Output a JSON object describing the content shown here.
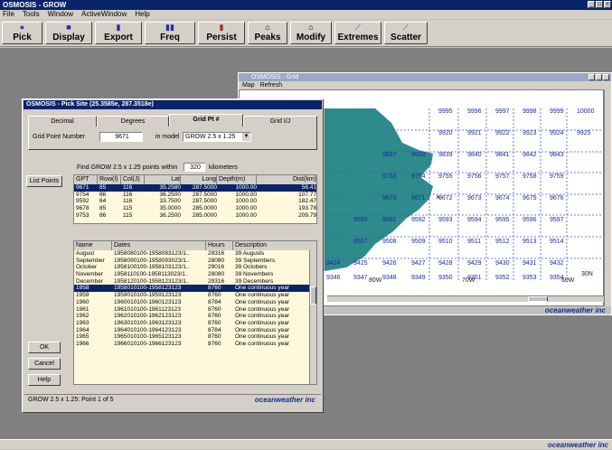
{
  "app": {
    "title": "OSMOSIS - GROW",
    "brand": "oceanweather inc"
  },
  "menu": [
    "File",
    "Tools",
    "Window",
    "ActiveWindow",
    "Help"
  ],
  "toolbar": [
    {
      "label": "Pick",
      "icon": "pick-icon",
      "glyph": "●",
      "color": "#1a4aa8"
    },
    {
      "label": "Display",
      "icon": "display-icon",
      "glyph": "■",
      "color": "#2a2aa8"
    },
    {
      "label": "Export",
      "icon": "export-icon",
      "glyph": "▮",
      "color": "#2a2aa8"
    },
    {
      "label": "Freq",
      "icon": "freq-icon",
      "glyph": "▮▮",
      "color": "#2a2aa8"
    },
    {
      "label": "Persist",
      "icon": "persist-icon",
      "glyph": "▮",
      "color": "#a82a2a"
    },
    {
      "label": "Peaks",
      "icon": "peaks-icon",
      "glyph": "⌂",
      "color": "#444"
    },
    {
      "label": "Modify",
      "icon": "modify-icon",
      "glyph": "⌂",
      "color": "#444"
    },
    {
      "label": "Extremes",
      "icon": "extremes-icon",
      "glyph": "⟋",
      "color": "#8a2a8a"
    },
    {
      "label": "Scatter",
      "icon": "scatter-icon",
      "glyph": "⟋",
      "color": "#a82a2a"
    }
  ],
  "grid": {
    "title": "OSMOSIS - Grid",
    "menu": [
      "Map",
      "Refresh"
    ],
    "rows": [
      [
        "",
        "",
        "",
        "",
        "9995",
        "9996",
        "9997",
        "9998",
        "9999",
        "10000"
      ],
      [
        "",
        "",
        "",
        "",
        "9920",
        "9921",
        "9922",
        "9923",
        "9924",
        "9925"
      ],
      [
        "",
        "",
        "9837",
        "9838",
        "9839",
        "9840",
        "9841",
        "9842",
        "9843",
        ""
      ],
      [
        "",
        "",
        "9753",
        "9754",
        "9755",
        "9756",
        "9757",
        "9758",
        "9759",
        ""
      ],
      [
        "",
        "",
        "9670",
        "9671",
        "9672",
        "9673",
        "9674",
        "9675",
        "9676",
        ""
      ],
      [
        "",
        "9590",
        "9591",
        "9592",
        "9593",
        "9594",
        "9595",
        "9596",
        "9597",
        ""
      ],
      [
        "",
        "9507",
        "9508",
        "9509",
        "9510",
        "9511",
        "9512",
        "9513",
        "9514",
        ""
      ],
      [
        "9424",
        "9425",
        "9426",
        "9427",
        "9428",
        "9429",
        "9430",
        "9431",
        "9432",
        ""
      ],
      [
        "9346",
        "9347",
        "9348",
        "9349",
        "9350",
        "9351",
        "9352",
        "9353",
        "9354",
        ""
      ]
    ],
    "x_labels": [
      "80W",
      "70W",
      "60W"
    ],
    "y_label": "30N"
  },
  "pick": {
    "title": "OSMOSIS - Pick Site (25.3585e, 287.3518e)",
    "tabs": [
      "Decimal",
      "Degrees",
      "Grid Pt #",
      "Grid I/J"
    ],
    "grid_point_label": "Grid Point Number",
    "grid_point_value": "9671",
    "model_label": "in model",
    "model_value": "GROW 2.5 x 1.25",
    "find_prefix": "Find GROW 2.5 x 1.25 points within",
    "find_value": "320",
    "find_suffix": "kilometers",
    "list_points_label": "List Points",
    "points_headers": [
      "GPT",
      "Row(I)",
      "Col(J)",
      "Lat",
      "Long",
      "Depth(m)",
      "Dist(km)"
    ],
    "points": [
      [
        "9671",
        "85",
        "116",
        "35.2580",
        "287.5000",
        "1000.00",
        "56.41"
      ],
      [
        "9754",
        "86",
        "116",
        "36.2500",
        "287.5000",
        "1000.00",
        "107.77"
      ],
      [
        "9592",
        "84",
        "116",
        "33.7500",
        "287.5000",
        "1000.00",
        "182.47"
      ],
      [
        "9678",
        "85",
        "115",
        "35.0000",
        "285.0000",
        "1000.00",
        "193.78"
      ],
      [
        "9753",
        "86",
        "115",
        "36.2500",
        "285.0000",
        "1000.00",
        "209.79"
      ]
    ],
    "periods_headers": [
      "Name",
      "Dates",
      "Hours",
      "Description"
    ],
    "periods": [
      [
        "August",
        "1958080100-1958083123/1..",
        "29316",
        "39 Augusts"
      ],
      [
        "September",
        "1958090100-1958093023/1..",
        "28080",
        "39 Septembers"
      ],
      [
        "October",
        "1958100100-1958103123/1..",
        "29016",
        "39 Octobers"
      ],
      [
        "November",
        "1958110100-1958113023/1..",
        "28080",
        "39 Novembers"
      ],
      [
        "December",
        "1958120100-1958123123/1..",
        "29316",
        "39 Decembers"
      ],
      [
        "1958",
        "1958010100-1958123123",
        "8760",
        "One continuous year"
      ],
      [
        "1959",
        "1959010100-1959123123",
        "8760",
        "One continuous year"
      ],
      [
        "1960",
        "1960010100-1960123123",
        "8784",
        "One continuous year"
      ],
      [
        "1961",
        "1961010100-1961123123",
        "8760",
        "One continuous year"
      ],
      [
        "1962",
        "1962010100-1962123123",
        "8760",
        "One continuous year"
      ],
      [
        "1963",
        "1963010100-1963123123",
        "8760",
        "One continuous year"
      ],
      [
        "1964",
        "1964010100-1964123123",
        "8784",
        "One continuous year"
      ],
      [
        "1965",
        "1965010100-1965123123",
        "8760",
        "One continuous year"
      ],
      [
        "1966",
        "1966010100-1966123123",
        "8760",
        "One continuous year"
      ]
    ],
    "ok_label": "OK",
    "cancel_label": "Cancel",
    "help_label": "Help",
    "status": "GROW 2.5 x 1.25: Point 1 of 5"
  }
}
